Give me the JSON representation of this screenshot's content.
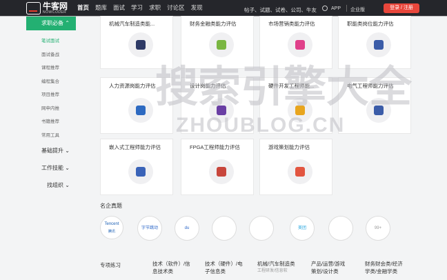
{
  "header": {
    "logo_name": "牛客网",
    "logo_sub": "NOWCODER",
    "nav": [
      "首页",
      "题库",
      "面试",
      "学习",
      "求职",
      "讨论区",
      "发现"
    ],
    "search_placeholder": "帖子、试题、试卷、公司、牛友",
    "app": "APP",
    "enterprise": "企业版",
    "login": "登录 / 注册"
  },
  "sidebar": {
    "head": "求职必备",
    "subs": [
      "笔试面试",
      "面试备战",
      "课程推荐",
      "编程集合",
      "项目推荐",
      "网申内推",
      "书籍推荐",
      "常用工具"
    ],
    "groups": [
      "基础提升",
      "工作技能",
      "找组织"
    ]
  },
  "cards": [
    {
      "title": "机械汽车制造类能..."
    },
    {
      "title": "财务金融类能力评估"
    },
    {
      "title": "市场营销类能力评估"
    },
    {
      "title": "职能类岗位能力评估"
    },
    {
      "title": "人力资源岗能力评估"
    },
    {
      "title": "设计岗能力评估"
    },
    {
      "title": "硬件开发工程师能..."
    },
    {
      "title": "电气工程师能力评估"
    },
    {
      "title": "嵌入式工程师能力评估"
    },
    {
      "title": "FPGA工程师能力评估"
    },
    {
      "title": "游戏策划能力评估"
    }
  ],
  "icons": [
    "chart-bar-icon",
    "yen-card-icon",
    "megaphone-icon",
    "person-tie-icon",
    "hr-person-icon",
    "pencil-ruler-icon",
    "chip-icon",
    "plug-icon",
    "embedded-chip-icon",
    "fpga-tree-icon",
    "bulb-flag-icon"
  ],
  "companies_title": "名企真题",
  "companies": [
    {
      "label": "Tencent",
      "sub": "腾讯"
    },
    {
      "label": "字节跳动"
    },
    {
      "label": "du"
    },
    {
      "label": ""
    },
    {
      "label": ""
    },
    {
      "label": "美团"
    },
    {
      "label": ""
    },
    {
      "label": "99+"
    }
  ],
  "categories": [
    {
      "label": "专项练习"
    },
    {
      "label": "技术（软件）/信",
      "line2": "息技术类"
    },
    {
      "label": "技术（硬件）/电",
      "line2": "子信息类"
    },
    {
      "label": "机械/汽车制造类",
      "line2": "工程研发/信息软"
    },
    {
      "label": "产品/运营/游戏",
      "line2": "策划/设计类"
    },
    {
      "label": "财务财会类/经济",
      "line2": "学类/金融学类"
    }
  ],
  "watermark": {
    "cn": "搜索引擎大全",
    "en": "ZHOUBLOG.CN"
  },
  "colors": {
    "brand_green": "#23b072",
    "login_red": "#e8463b",
    "header_bg": "#25262b"
  }
}
